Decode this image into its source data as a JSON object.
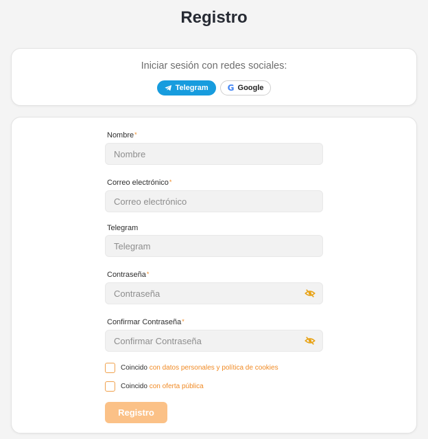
{
  "page": {
    "title": "Registro"
  },
  "social": {
    "title": "Iniciar sesión con redes sociales:",
    "telegram_label": "Telegram",
    "google_label": "Google",
    "telegram_color": "#179cde"
  },
  "form": {
    "name": {
      "label": "Nombre",
      "required": "*",
      "placeholder": "Nombre",
      "value": ""
    },
    "email": {
      "label": "Correo electrónico",
      "required": "*",
      "placeholder": "Correo electrónico",
      "value": ""
    },
    "telegram": {
      "label": "Telegram",
      "placeholder": "Telegram",
      "value": ""
    },
    "password": {
      "label": "Contraseña",
      "required": "*",
      "placeholder": "Contraseña",
      "value": "",
      "icon": "eye-off-icon"
    },
    "confirm": {
      "label": "Confirmar Contraseña",
      "required": "*",
      "placeholder": "Confirmar Contraseña",
      "value": "",
      "icon": "eye-off-icon"
    },
    "consent_personal": {
      "text": "Coincido",
      "link": "con datos personales y política de cookies",
      "checked": false
    },
    "consent_offer": {
      "text": "Coincido",
      "link": "con oferta pública",
      "checked": false
    },
    "submit_label": "Registro"
  },
  "colors": {
    "accent": "#f08a24",
    "button_disabled": "#fbc187",
    "background": "#f4f4f4"
  }
}
